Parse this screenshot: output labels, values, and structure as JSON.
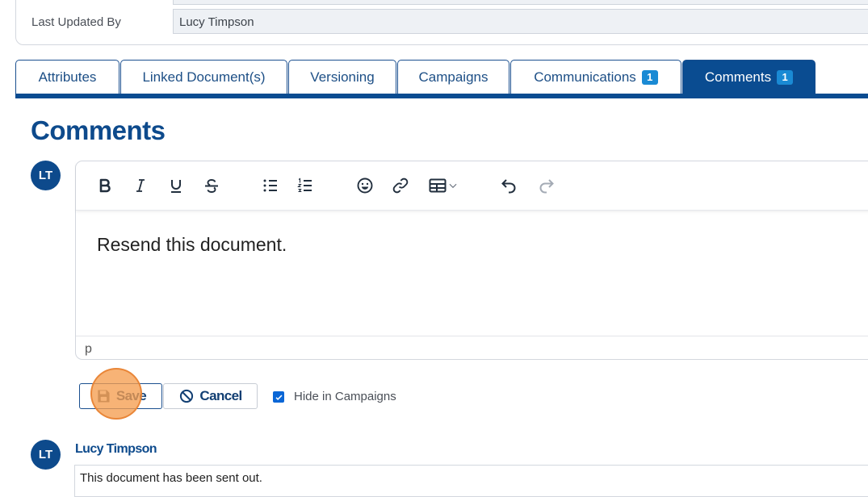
{
  "attributes": {
    "last_updated_by_label": "Last Updated By",
    "last_updated_by_value": "Lucy Timpson"
  },
  "tabs": [
    {
      "label": "Attributes",
      "badge": null,
      "active": false
    },
    {
      "label": "Linked Document(s)",
      "badge": null,
      "active": false
    },
    {
      "label": "Versioning",
      "badge": null,
      "active": false
    },
    {
      "label": "Campaigns",
      "badge": null,
      "active": false
    },
    {
      "label": "Communications",
      "badge": "1",
      "active": false
    },
    {
      "label": "Comments",
      "badge": "1",
      "active": true
    }
  ],
  "comments_section": {
    "title": "Comments",
    "current_user_initials": "LT"
  },
  "editor": {
    "toolbar": [
      "bold-icon",
      "italic-icon",
      "underline-icon",
      "strikethrough-icon",
      "bullet-list-icon",
      "numbered-list-icon",
      "emoji-icon",
      "link-icon",
      "table-icon",
      "undo-icon",
      "redo-icon"
    ],
    "content": "Resend this document.",
    "status_path": "p"
  },
  "actions": {
    "save_label": "Save",
    "cancel_label": "Cancel",
    "hide_in_campaigns_label": "Hide in Campaigns",
    "hide_in_campaigns_checked": true
  },
  "existing_comment": {
    "initials": "LT",
    "author": "Lucy Timpson",
    "text": "This document has been sent out."
  },
  "colors": {
    "brand_blue": "#0a4c91",
    "badge_blue": "#1a8ad4",
    "checkbox_blue": "#0a66d6",
    "click_marker": "#f59e50"
  }
}
